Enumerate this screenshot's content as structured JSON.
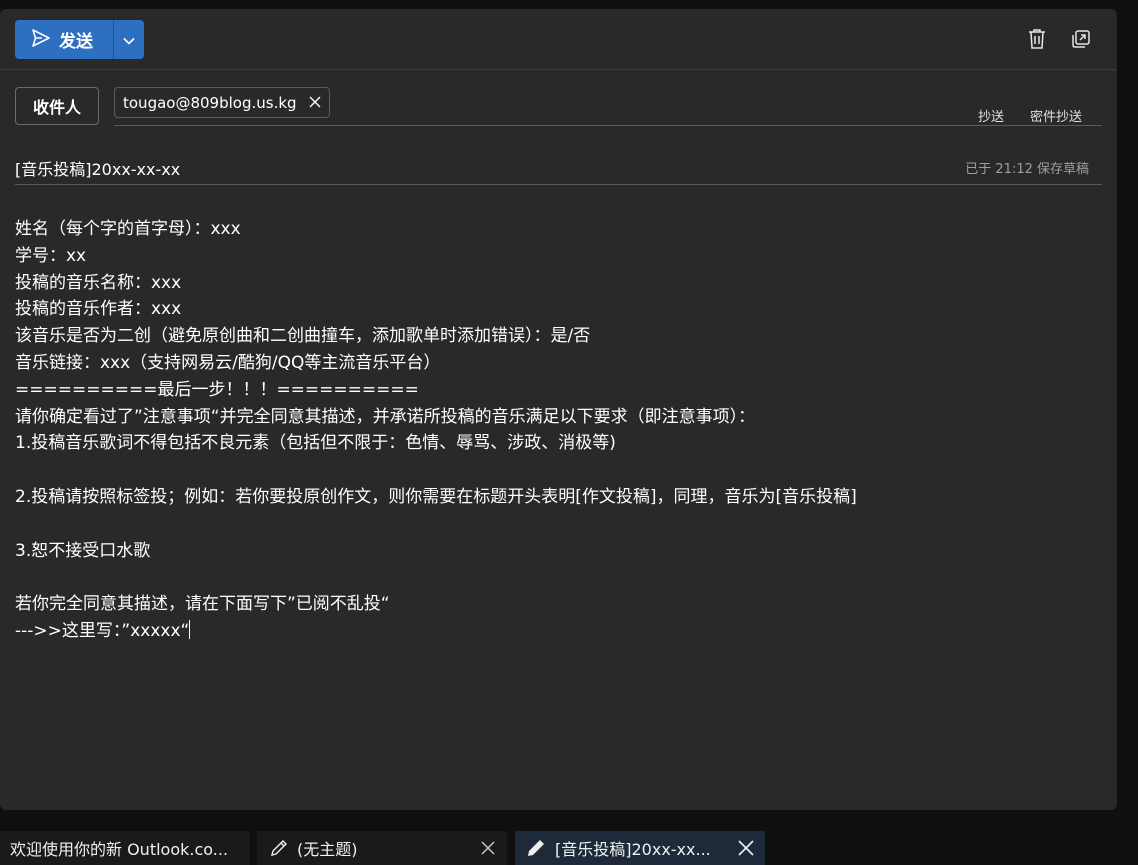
{
  "toolbar": {
    "send_label": "发送",
    "send_icon": "send-icon",
    "dropdown_icon": "chevron-down-icon",
    "delete_icon": "trash-icon",
    "popout_icon": "popout-icon",
    "accent_color": "#2d6fc0"
  },
  "recipients": {
    "to_label": "收件人",
    "to_chip": "tougao@809blog.us.kg",
    "cc_label": "抄送",
    "bcc_label": "密件抄送"
  },
  "subject": {
    "value": "[音乐投稿]20xx-xx-xx",
    "draft_status": "已于 21:12 保存草稿"
  },
  "body": {
    "lines": [
      "姓名（每个字的首字母）：xxx",
      "学号：xx",
      "投稿的音乐名称：xxx",
      "投稿的音乐作者：xxx",
      "该音乐是否为二创（避免原创曲和二创曲撞车，添加歌单时添加错误）：是/否",
      "音乐链接：xxx（支持网易云/酷狗/QQ等主流音乐平台）",
      "==========最后一步！！！==========",
      "请你确定看过了”注意事项“并完全同意其描述，并承诺所投稿的音乐满足以下要求（即注意事项）：",
      "1.投稿音乐歌词不得包括不良元素（包括但不限于：色情、辱骂、涉政、消极等)",
      "",
      "2.投稿请按照标签投；例如：若你要投原创作文，则你需要在标题开头表明[作文投稿]，同理，音乐为[音乐投稿]",
      "",
      "3.恕不接受口水歌",
      "",
      "若你完全同意其描述，请在下面写下”已阅不乱投“",
      "--->>这里写：”xxxxx“"
    ]
  },
  "tabs": [
    {
      "label": "欢迎使用你的新 Outlook.co...",
      "icon": ""
    },
    {
      "label": "(无主题)",
      "icon": "pencil-icon"
    },
    {
      "label": "[音乐投稿]20xx-xx...",
      "icon": "pencil-icon"
    }
  ]
}
